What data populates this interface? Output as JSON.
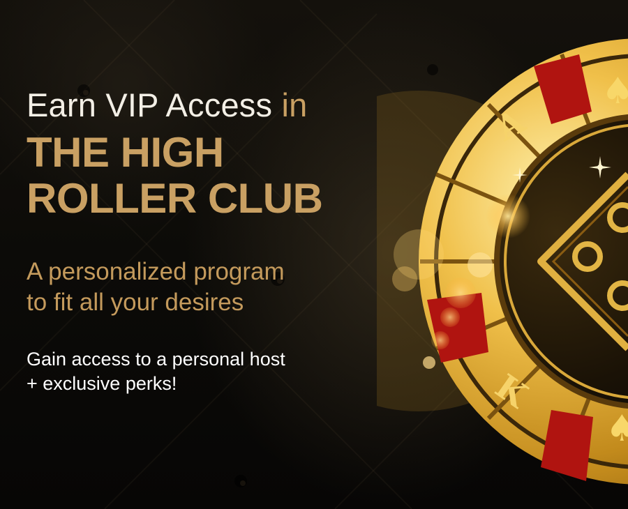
{
  "headline": {
    "lead": "Earn VIP Access",
    "connector": "in",
    "title_line1": "THE HIGH",
    "title_line2": "ROLLER CLUB"
  },
  "subheadline": {
    "line1": "A personalized program",
    "line2": "to fit all your desires"
  },
  "perks": {
    "line1": "Gain access to a personal host",
    "line2": "+ exclusive perks!"
  },
  "chip_faces": {
    "card_letter_top": "A",
    "card_letter_bottom": "K",
    "suit_symbol": "♠"
  },
  "colors": {
    "gold": "#c9a063",
    "gold_subheading": "#c49a5c",
    "cream_text": "#f3efe6",
    "white_text": "#ffffff",
    "background": "#0b0a08",
    "chip_red": "#b01410"
  },
  "decoration_icons": [
    "quilted-leather-background",
    "casino-chip-icon",
    "bokeh-sparkles"
  ]
}
